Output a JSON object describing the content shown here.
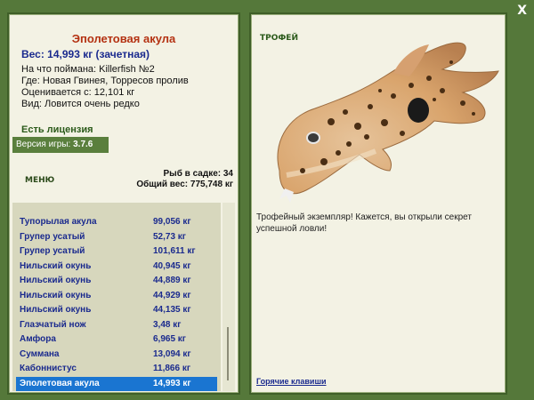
{
  "fish": {
    "name": "Эполетовая акула",
    "weight": "Вес: 14,993 кг (зачетная)",
    "caught_with": "На что поймана: Killerfish №2",
    "location": "Где: Новая Гвинея, Торресов пролив",
    "valued": "Оценивается с: 12,101 кг",
    "kind": "Вид: Ловится очень редко"
  },
  "license": "Есть лицензия",
  "version_label": "Версия игры:",
  "version_value": "3.7.6",
  "menu": "МЕНЮ",
  "stats": {
    "fish_count": "Рыб в садке: 34",
    "total_weight": "Общий вес: 775,748 кг"
  },
  "catch_list": [
    {
      "name": "Тупорылая акула",
      "weight": "99,056 кг"
    },
    {
      "name": "Групер усатый",
      "weight": "52,73 кг"
    },
    {
      "name": "Групер усатый",
      "weight": "101,611 кг"
    },
    {
      "name": "Нильский окунь",
      "weight": "40,945 кг"
    },
    {
      "name": "Нильский окунь",
      "weight": "44,889 кг"
    },
    {
      "name": "Нильский окунь",
      "weight": "44,929 кг"
    },
    {
      "name": "Нильский окунь",
      "weight": "44,135 кг"
    },
    {
      "name": "Глазчатый нож",
      "weight": "3,48 кг"
    },
    {
      "name": "Амфора",
      "weight": "6,965 кг"
    },
    {
      "name": "Суммана",
      "weight": "13,094 кг"
    },
    {
      "name": "Кабоннистус",
      "weight": "11,866 кг"
    },
    {
      "name": "Эполетовая акула",
      "weight": "14,993 кг"
    }
  ],
  "selected_index": 11,
  "trophy": {
    "title": "ТРОФЕЙ",
    "text": "Трофейный экземпляр! Кажется, вы открыли секрет успешной ловли!",
    "hotkeys": "Горячие клавиши"
  },
  "close_label": "X"
}
